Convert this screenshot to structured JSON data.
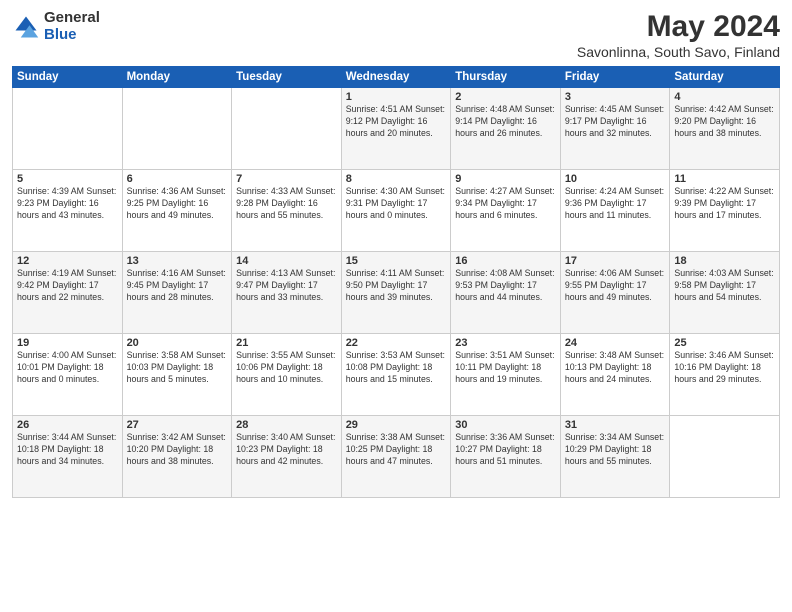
{
  "logo": {
    "general": "General",
    "blue": "Blue"
  },
  "title": "May 2024",
  "subtitle": "Savonlinna, South Savo, Finland",
  "headers": [
    "Sunday",
    "Monday",
    "Tuesday",
    "Wednesday",
    "Thursday",
    "Friday",
    "Saturday"
  ],
  "weeks": [
    [
      {
        "day": "",
        "info": ""
      },
      {
        "day": "",
        "info": ""
      },
      {
        "day": "",
        "info": ""
      },
      {
        "day": "1",
        "info": "Sunrise: 4:51 AM\nSunset: 9:12 PM\nDaylight: 16 hours\nand 20 minutes."
      },
      {
        "day": "2",
        "info": "Sunrise: 4:48 AM\nSunset: 9:14 PM\nDaylight: 16 hours\nand 26 minutes."
      },
      {
        "day": "3",
        "info": "Sunrise: 4:45 AM\nSunset: 9:17 PM\nDaylight: 16 hours\nand 32 minutes."
      },
      {
        "day": "4",
        "info": "Sunrise: 4:42 AM\nSunset: 9:20 PM\nDaylight: 16 hours\nand 38 minutes."
      }
    ],
    [
      {
        "day": "5",
        "info": "Sunrise: 4:39 AM\nSunset: 9:23 PM\nDaylight: 16 hours\nand 43 minutes."
      },
      {
        "day": "6",
        "info": "Sunrise: 4:36 AM\nSunset: 9:25 PM\nDaylight: 16 hours\nand 49 minutes."
      },
      {
        "day": "7",
        "info": "Sunrise: 4:33 AM\nSunset: 9:28 PM\nDaylight: 16 hours\nand 55 minutes."
      },
      {
        "day": "8",
        "info": "Sunrise: 4:30 AM\nSunset: 9:31 PM\nDaylight: 17 hours\nand 0 minutes."
      },
      {
        "day": "9",
        "info": "Sunrise: 4:27 AM\nSunset: 9:34 PM\nDaylight: 17 hours\nand 6 minutes."
      },
      {
        "day": "10",
        "info": "Sunrise: 4:24 AM\nSunset: 9:36 PM\nDaylight: 17 hours\nand 11 minutes."
      },
      {
        "day": "11",
        "info": "Sunrise: 4:22 AM\nSunset: 9:39 PM\nDaylight: 17 hours\nand 17 minutes."
      }
    ],
    [
      {
        "day": "12",
        "info": "Sunrise: 4:19 AM\nSunset: 9:42 PM\nDaylight: 17 hours\nand 22 minutes."
      },
      {
        "day": "13",
        "info": "Sunrise: 4:16 AM\nSunset: 9:45 PM\nDaylight: 17 hours\nand 28 minutes."
      },
      {
        "day": "14",
        "info": "Sunrise: 4:13 AM\nSunset: 9:47 PM\nDaylight: 17 hours\nand 33 minutes."
      },
      {
        "day": "15",
        "info": "Sunrise: 4:11 AM\nSunset: 9:50 PM\nDaylight: 17 hours\nand 39 minutes."
      },
      {
        "day": "16",
        "info": "Sunrise: 4:08 AM\nSunset: 9:53 PM\nDaylight: 17 hours\nand 44 minutes."
      },
      {
        "day": "17",
        "info": "Sunrise: 4:06 AM\nSunset: 9:55 PM\nDaylight: 17 hours\nand 49 minutes."
      },
      {
        "day": "18",
        "info": "Sunrise: 4:03 AM\nSunset: 9:58 PM\nDaylight: 17 hours\nand 54 minutes."
      }
    ],
    [
      {
        "day": "19",
        "info": "Sunrise: 4:00 AM\nSunset: 10:01 PM\nDaylight: 18 hours\nand 0 minutes."
      },
      {
        "day": "20",
        "info": "Sunrise: 3:58 AM\nSunset: 10:03 PM\nDaylight: 18 hours\nand 5 minutes."
      },
      {
        "day": "21",
        "info": "Sunrise: 3:55 AM\nSunset: 10:06 PM\nDaylight: 18 hours\nand 10 minutes."
      },
      {
        "day": "22",
        "info": "Sunrise: 3:53 AM\nSunset: 10:08 PM\nDaylight: 18 hours\nand 15 minutes."
      },
      {
        "day": "23",
        "info": "Sunrise: 3:51 AM\nSunset: 10:11 PM\nDaylight: 18 hours\nand 19 minutes."
      },
      {
        "day": "24",
        "info": "Sunrise: 3:48 AM\nSunset: 10:13 PM\nDaylight: 18 hours\nand 24 minutes."
      },
      {
        "day": "25",
        "info": "Sunrise: 3:46 AM\nSunset: 10:16 PM\nDaylight: 18 hours\nand 29 minutes."
      }
    ],
    [
      {
        "day": "26",
        "info": "Sunrise: 3:44 AM\nSunset: 10:18 PM\nDaylight: 18 hours\nand 34 minutes."
      },
      {
        "day": "27",
        "info": "Sunrise: 3:42 AM\nSunset: 10:20 PM\nDaylight: 18 hours\nand 38 minutes."
      },
      {
        "day": "28",
        "info": "Sunrise: 3:40 AM\nSunset: 10:23 PM\nDaylight: 18 hours\nand 42 minutes."
      },
      {
        "day": "29",
        "info": "Sunrise: 3:38 AM\nSunset: 10:25 PM\nDaylight: 18 hours\nand 47 minutes."
      },
      {
        "day": "30",
        "info": "Sunrise: 3:36 AM\nSunset: 10:27 PM\nDaylight: 18 hours\nand 51 minutes."
      },
      {
        "day": "31",
        "info": "Sunrise: 3:34 AM\nSunset: 10:29 PM\nDaylight: 18 hours\nand 55 minutes."
      },
      {
        "day": "",
        "info": ""
      }
    ]
  ]
}
